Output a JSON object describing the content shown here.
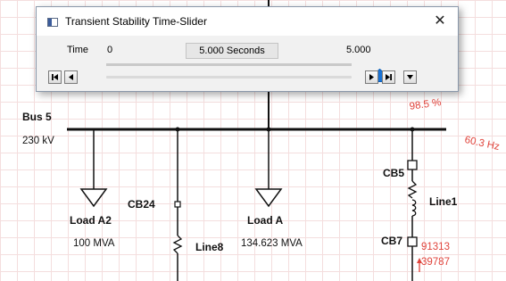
{
  "dialog": {
    "title": "Transient Stability Time-Slider",
    "close_glyph": "✕",
    "time_label": "Time",
    "min_value": "0",
    "current_value": "5.000 Seconds",
    "max_value": "5.000",
    "slider_position_fraction": 1.0,
    "controls": [
      "skip-to-start-icon",
      "step-back-icon",
      "step-forward-icon",
      "skip-to-end-icon",
      "dropdown-arrow-icon"
    ]
  },
  "diagram": {
    "bus": {
      "name": "Bus 5",
      "voltage": "230 kV"
    },
    "bus_readouts": {
      "percent": "98.5 %",
      "frequency": "60.3 Hz"
    },
    "loads": [
      {
        "name": "Load A2",
        "rating": "100 MVA"
      },
      {
        "name": "Load A",
        "rating": "134.623 MVA"
      }
    ],
    "branches": [
      {
        "breaker": "CB24",
        "line": "Line8"
      },
      {
        "breaker_top": "CB5",
        "line": "Line1",
        "breaker_bottom": "CB7"
      }
    ],
    "flow_readouts": [
      "91313",
      "39787"
    ]
  },
  "colors": {
    "readout": "#e0443c",
    "grid": "#f4dede",
    "slider_thumb": "#1a73d6"
  }
}
